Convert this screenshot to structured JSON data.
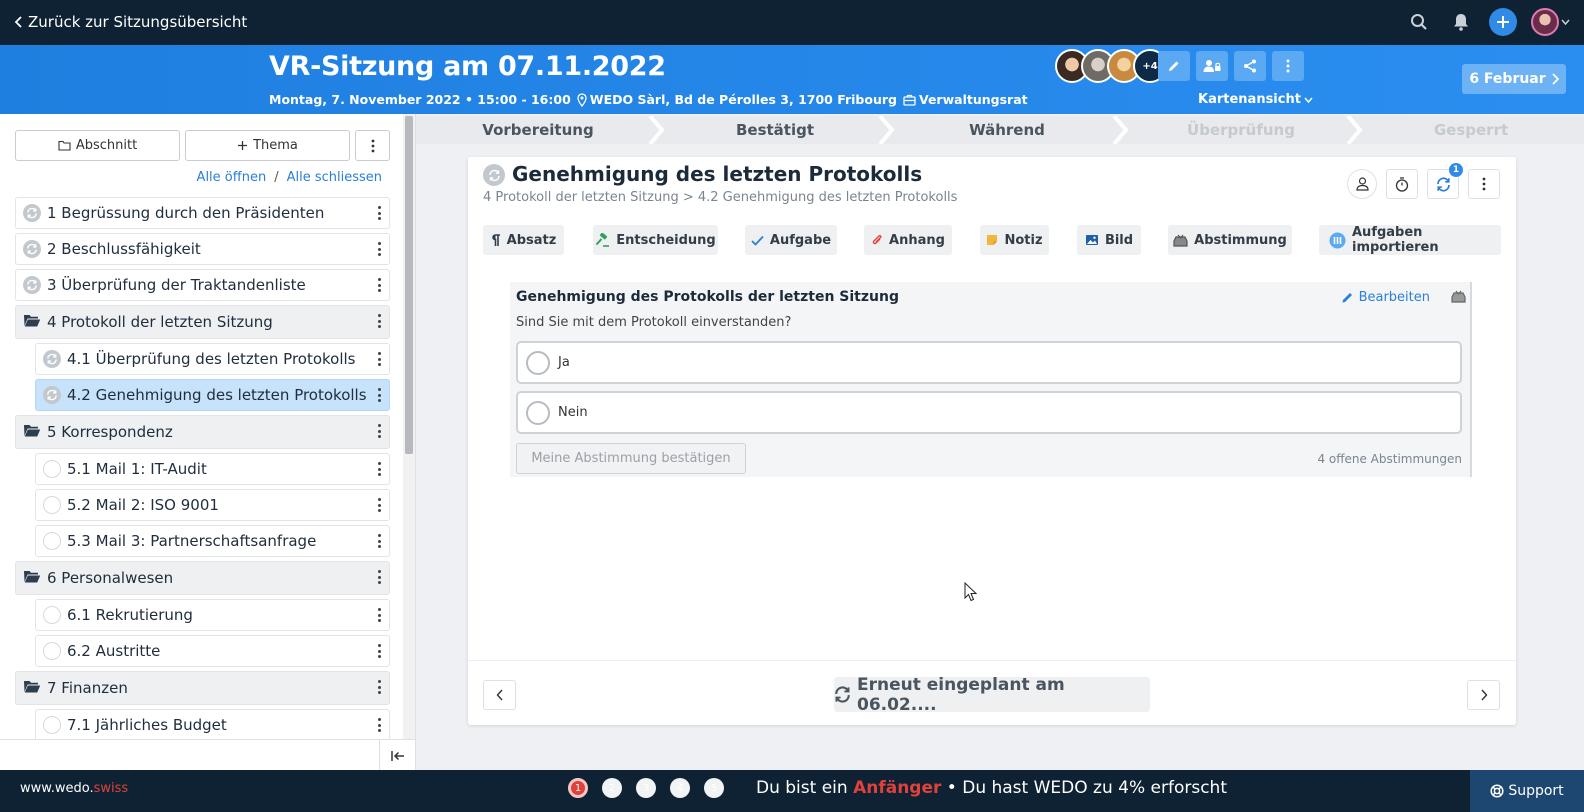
{
  "topbar": {
    "back_label": "Zurück zur Sitzungsübersicht"
  },
  "header": {
    "title": "VR-Sitzung am 07.11.2022",
    "date_time": "Montag, 7. November 2022 • 15:00 - 16:00",
    "location": "WEDO Sàrl, Bd de Pérolles 3, 1700 Fribourg",
    "committee": "Verwaltungsrat",
    "more_participants": "+4",
    "view_mode": "Kartenansicht",
    "next_meeting": "6 Februar"
  },
  "sidebar": {
    "section_button": "Abschnitt",
    "topic_button": "Thema",
    "open_all": "Alle öffnen",
    "separator": "/",
    "close_all": "Alle schliessen",
    "items": [
      {
        "label": "1 Begrüssung durch den Präsidenten",
        "kind": "ref"
      },
      {
        "label": "2 Beschlussfähigkeit",
        "kind": "ref"
      },
      {
        "label": "3 Überprüfung der Traktandenliste",
        "kind": "ref"
      },
      {
        "label": "4 Protokoll der letzten Sitzung",
        "kind": "folder"
      },
      {
        "label": "4.1 Überprüfung des letzten Protokolls",
        "kind": "ref-sub"
      },
      {
        "label": "4.2 Genehmigung des letzten Protokolls",
        "kind": "ref-sub-active"
      },
      {
        "label": "5 Korrespondenz",
        "kind": "folder"
      },
      {
        "label": "5.1 Mail 1: IT-Audit",
        "kind": "sub"
      },
      {
        "label": "5.2 Mail 2: ISO 9001",
        "kind": "sub"
      },
      {
        "label": "5.3 Mail 3: Partnerschaftsanfrage",
        "kind": "sub"
      },
      {
        "label": "6 Personalwesen",
        "kind": "folder"
      },
      {
        "label": "6.1 Rekrutierung",
        "kind": "sub"
      },
      {
        "label": "6.2 Austritte",
        "kind": "sub"
      },
      {
        "label": "7 Finanzen",
        "kind": "folder"
      },
      {
        "label": "7.1 Jährliches Budget",
        "kind": "sub"
      }
    ]
  },
  "stepper": {
    "steps": [
      "Vorbereitung",
      "Bestätigt",
      "Während",
      "Überprüfung",
      "Gesperrt"
    ]
  },
  "card": {
    "title": "Genehmigung des letzten Protokolls",
    "breadcrumb": "4 Protokoll der letzten Sitzung > 4.2 Genehmigung des letzten Protokolls",
    "sync_badge": "1",
    "toolbar": [
      "Absatz",
      "Entscheidung",
      "Aufgabe",
      "Anhang",
      "Notiz",
      "Bild",
      "Abstimmung",
      "Aufgaben importieren"
    ],
    "vote": {
      "title": "Genehmigung des Protokolls der letzten Sitzung",
      "edit_label": "Bearbeiten",
      "question": "Sind Sie mit dem Protokoll einverstanden?",
      "options": [
        "Ja",
        "Nein"
      ],
      "confirm_label": "Meine Abstimmung bestätigen",
      "open_votes": "4 offene Abstimmungen"
    },
    "rescheduled_label": "Erneut eingeplant am 06.02...."
  },
  "bottombar": {
    "brand_main": "www.wedo.",
    "brand_accent": "swiss",
    "step_dots": [
      "1",
      "2",
      "3",
      "4",
      "5"
    ],
    "progress_prefix": "Du bist ein ",
    "progress_level": "Anfänger",
    "progress_suffix": " • Du hast WEDO zu 4% erforscht",
    "support_label": "Support"
  },
  "colors": {
    "dark_nav": "#0e2233",
    "header_blue": "#1f7fe0",
    "accent_red": "#e0413b",
    "link_blue": "#2a7fd6",
    "active_item": "#c7e2fb"
  }
}
